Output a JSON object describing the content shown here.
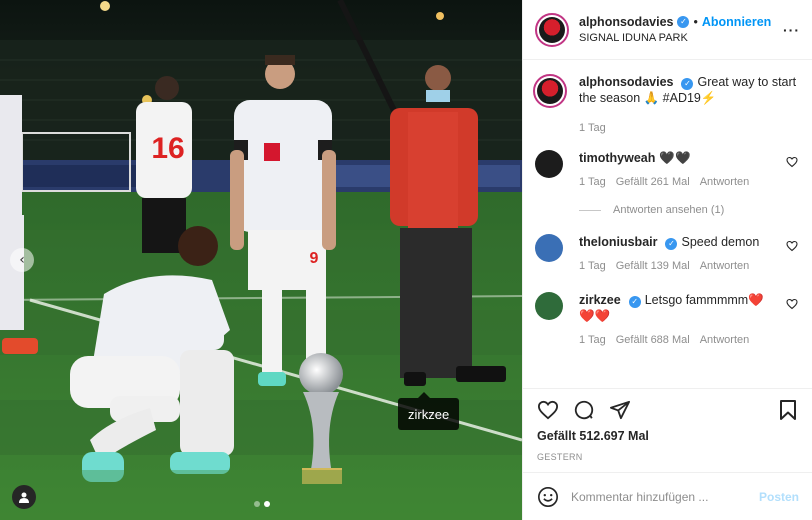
{
  "post": {
    "username": "alphonsodavies",
    "separator": "•",
    "follow_label": "Abonnieren",
    "location": "SIGNAL IDUNA PARK",
    "more_icon": "more-icon"
  },
  "photo": {
    "tag_tooltip": "zirkzee",
    "carousel": {
      "count": 2,
      "active": 2
    },
    "jersey_numbers": [
      "16",
      "9"
    ]
  },
  "caption": {
    "username": "alphonsodavies",
    "text": "Great way to start the season 🙏 #AD19⚡",
    "time": "1 Tag"
  },
  "comments": [
    {
      "username": "timothyweah",
      "text": "🖤🖤",
      "time": "1 Tag",
      "likes": "Gefällt 261 Mal",
      "reply": "Antworten",
      "view_replies": "Antworten ansehen (1)",
      "verified": false,
      "avatar_color": "#1c1c1c"
    },
    {
      "username": "theloniusbair",
      "text": "Speed demon",
      "time": "1 Tag",
      "likes": "Gefällt 139 Mal",
      "reply": "Antworten",
      "verified": true,
      "avatar_color": "#3a6fb5"
    },
    {
      "username": "zirkzee",
      "text": "Letsgo fammmmm❤️❤️❤️",
      "time": "1 Tag",
      "likes": "Gefällt 688 Mal",
      "reply": "Antworten",
      "verified": true,
      "avatar_color": "#2f6b3a"
    }
  ],
  "footer": {
    "likes_text": "Gefällt 512.697 Mal",
    "date": "GESTERN",
    "comment_placeholder": "Kommentar hinzufügen ...",
    "post_label": "Posten"
  },
  "colors": {
    "accent": "#0095f6",
    "verified": "#3897f0",
    "muted": "#8e8e8e"
  }
}
